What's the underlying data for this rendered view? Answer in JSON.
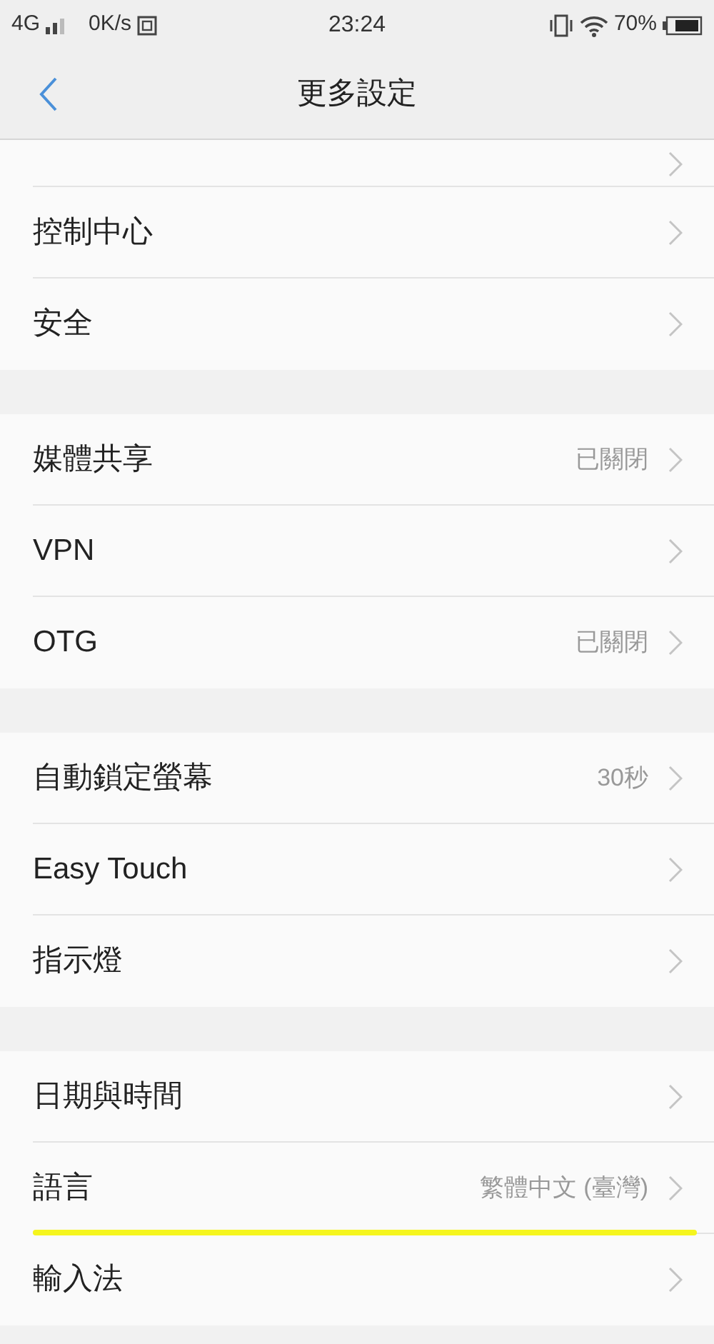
{
  "status_bar": {
    "network": "4G",
    "speed": "0K/s",
    "time": "23:24",
    "battery": "70%"
  },
  "header": {
    "title": "更多設定"
  },
  "sections": [
    {
      "rows": [
        {
          "kind": "cut",
          "highlighted": false
        },
        {
          "kind": "normal",
          "label": "控制中心",
          "highlighted": false
        },
        {
          "kind": "normal",
          "label": "安全",
          "highlighted": false
        }
      ]
    },
    {
      "rows": [
        {
          "kind": "normal",
          "label": "媒體共享",
          "value": "已關閉",
          "highlighted": false
        },
        {
          "kind": "normal",
          "label": "VPN",
          "highlighted": false
        },
        {
          "kind": "normal",
          "label": "OTG",
          "value": "已關閉",
          "highlighted": false
        }
      ]
    },
    {
      "rows": [
        {
          "kind": "normal",
          "label": "自動鎖定螢幕",
          "value": "30秒",
          "highlighted": false
        },
        {
          "kind": "normal",
          "label": "Easy Touch",
          "highlighted": false
        },
        {
          "kind": "normal",
          "label": "指示燈",
          "highlighted": false
        }
      ]
    },
    {
      "rows": [
        {
          "kind": "normal",
          "label": "日期與時間",
          "highlighted": false
        },
        {
          "kind": "normal",
          "label": "語言",
          "value": "繁體中文 (臺灣)",
          "highlighted": true
        },
        {
          "kind": "normal",
          "label": "輸入法",
          "highlighted": false
        }
      ]
    }
  ]
}
